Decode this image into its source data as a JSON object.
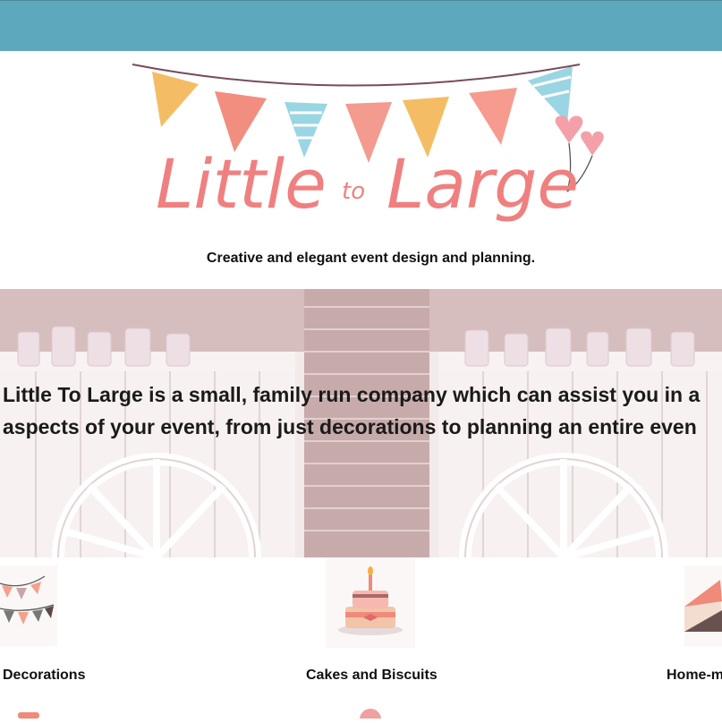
{
  "header": {
    "bar_color": "#5ea8bd"
  },
  "logo": {
    "word1": "Little",
    "word2": "to",
    "word3": "Large",
    "color": "#f08080"
  },
  "tagline": "Creative and elegant event design and planning.",
  "hero": {
    "line1": "Little To Large is a small, family run company which can assist you in a",
    "line2": "aspects of your event, from just decorations to planning an entire even"
  },
  "services": [
    {
      "label": "Decorations",
      "icon": "bunting-icon"
    },
    {
      "label": "Cakes and Biscuits",
      "icon": "cake-icon"
    },
    {
      "label": "Home-m",
      "icon": "envelope-icon"
    }
  ]
}
